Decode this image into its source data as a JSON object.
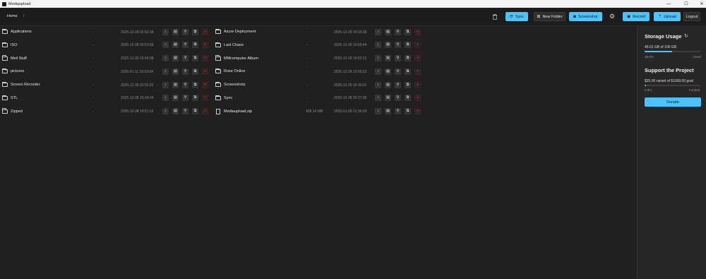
{
  "window": {
    "title": "Mediaupload",
    "min": "—",
    "max": "☐",
    "close": "✕"
  },
  "toolbar": {
    "breadcrumb": [
      "Home",
      "/"
    ],
    "sync": "Sync",
    "new_folder": "New Folder",
    "screenshot": "Screenshot",
    "record": "Record",
    "upload": "Upload",
    "logout": "Logout"
  },
  "left_files": [
    {
      "type": "folder",
      "name": "Applications",
      "size": "-",
      "date": "2025-12-28 02:53:38"
    },
    {
      "type": "folder",
      "name": "ISO",
      "size": "-",
      "date": "2025-12-28 00:53:59"
    },
    {
      "type": "folder",
      "name": "Meil Stuff",
      "size": "-",
      "date": "2025-12-30 19:46:38"
    },
    {
      "type": "folder",
      "name": "pictures",
      "size": "-",
      "date": "2026-01-11 03:52:04"
    },
    {
      "type": "folder",
      "name": "Screen Recorder",
      "size": "-",
      "date": "2025-12-30 22:52:22"
    },
    {
      "type": "folder",
      "name": "STL",
      "size": "-",
      "date": "2025-12-28 16:34:24"
    },
    {
      "type": "folder",
      "name": "Zipped",
      "size": "-",
      "date": "2025-12-28 19:51:16"
    }
  ],
  "right_files": [
    {
      "type": "folder",
      "name": "Azure Deployment",
      "size": "-",
      "date": "2025-12-28 20:29:38"
    },
    {
      "type": "folder",
      "name": "Last Chaos",
      "size": "-",
      "date": "2025-12-28 19:55:44"
    },
    {
      "type": "folder",
      "name": "MMcomputer Album",
      "size": "-",
      "date": "2025-12-28 19:52:21"
    },
    {
      "type": "folder",
      "name": "Rose Online",
      "size": "-",
      "date": "2025-12-28 19:55:23"
    },
    {
      "type": "folder",
      "name": "Screenshots",
      "size": "-",
      "date": "2025-12-29 19:35:01"
    },
    {
      "type": "folder",
      "name": "Sync",
      "size": "-",
      "date": "2025-12-28 02:27:36"
    },
    {
      "type": "file",
      "name": "Mediaupload.zip",
      "size": "458.14 MB",
      "date": "2026-01-05 21:36:29"
    }
  ],
  "actions": {
    "download": "↓",
    "save": "▤",
    "link": "⚲",
    "copy": "⧉",
    "delete": "▪"
  },
  "storage": {
    "title": "Storage Usage",
    "refresh": "↻",
    "usage_text": "49.01 GB of 100 GB",
    "percent_label": "49.0%",
    "used_label": "Used",
    "fraction": 0.49
  },
  "support": {
    "title": "Support the Project",
    "raised_text": "$25.00 raised of $1000.00 goal",
    "percent_label": "2.5%",
    "funded_label": "Funded",
    "fraction": 0.025,
    "donate": "Donate"
  },
  "colors": {
    "accent": "#4cc2ff",
    "delete": "#e04040"
  }
}
